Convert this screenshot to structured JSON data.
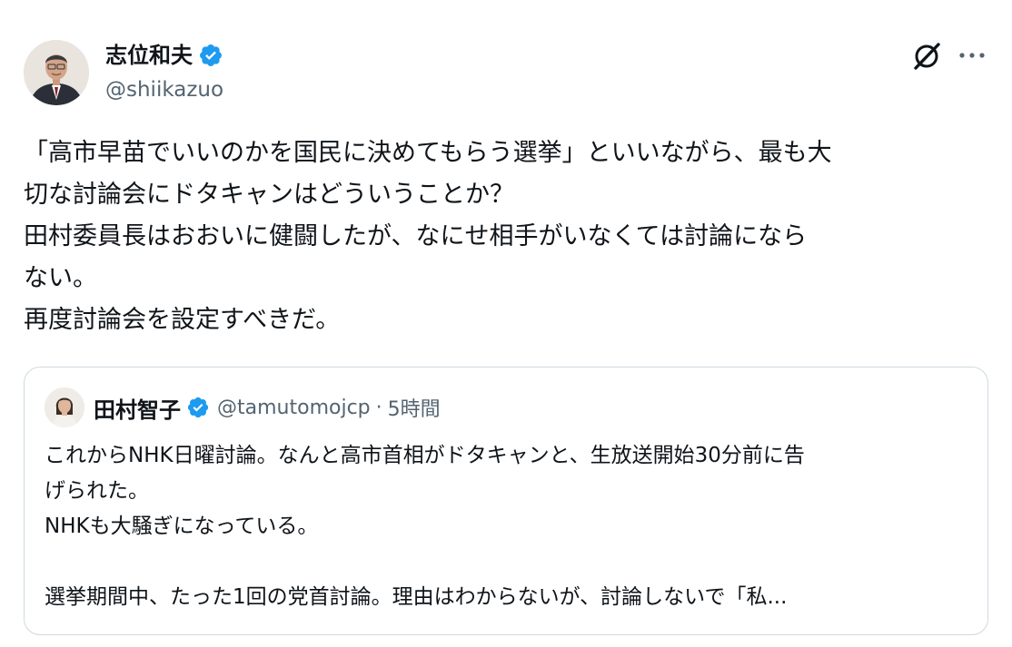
{
  "post": {
    "author": {
      "name": "志位和夫",
      "handle": "@shiikazuo",
      "verified": true
    },
    "text_lines": [
      "「高市早苗でいいのかを国民に決めてもらう選挙」といいながら、最も大",
      "切な討論会にドタキャンはどういうことか？",
      "田村委員長はおおいに健闘したが、なにせ相手がいなくては討論になら",
      "ない。",
      "再度討論会を設定すべきだ。"
    ],
    "icons": {
      "grok": "grok-icon",
      "more": "more-icon",
      "verified": "verified-badge-icon"
    }
  },
  "quoted_post": {
    "author": {
      "name": "田村智子",
      "handle": "@tamutomojcp",
      "separator": "·",
      "time": "5時間",
      "verified": true
    },
    "text_lines": [
      "これからNHK日曜討論。なんと高市首相がドタキャンと、生放送開始30分前に告",
      "げられた。",
      "NHKも大騒ぎになっている。",
      "",
      "選挙期間中、たった1回の党首討論。理由はわからないが、討論しないで「私..."
    ]
  },
  "colors": {
    "text": "#0f1419",
    "secondary": "#536471",
    "verified_blue": "#1d9bf0",
    "border": "#cfd9de"
  }
}
